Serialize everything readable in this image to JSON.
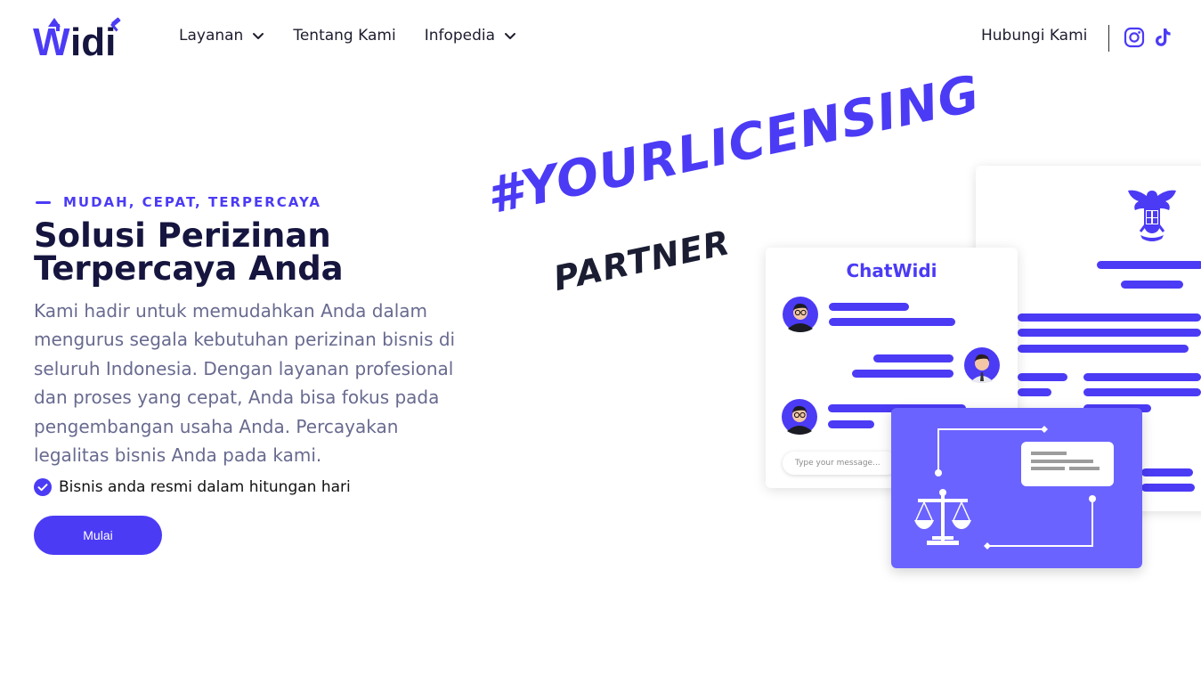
{
  "brand": {
    "name": "Widi",
    "color": "#4b3bf5"
  },
  "nav": {
    "items": [
      {
        "label": "Layanan",
        "has_dropdown": true
      },
      {
        "label": "Tentang Kami",
        "has_dropdown": false
      },
      {
        "label": "Infopedia",
        "has_dropdown": true
      }
    ],
    "contact_label": "Hubungi Kami",
    "social_icons": [
      "instagram-icon",
      "tiktok-icon"
    ]
  },
  "hero": {
    "eyebrow": "MUDAH, CEPAT, TERPERCAYA",
    "title_line1": "Solusi Perizinan",
    "title_line2": "Terpercaya Anda",
    "description": "Kami hadir untuk memudahkan Anda dalam mengurus segala kebutuhan perizinan bisnis di seluruh Indonesia. Dengan layanan profesional dan proses yang cepat, Anda bisa fokus pada pengembangan usaha Anda. Percayakan legalitas bisnis Anda pada kami.",
    "checkpoint": "Bisnis anda resmi dalam hitungan hari",
    "cta_label": "Mulai"
  },
  "illustration": {
    "hashtag": "#YOURLICENSING",
    "tagline": "PARTNER",
    "chat_title": "ChatWidi",
    "chat_placeholder": "Type your message..."
  },
  "colors": {
    "primary": "#4b3bf5",
    "heading": "#15153f",
    "body_text": "#686a8f",
    "card_purple": "#6b63ff"
  }
}
